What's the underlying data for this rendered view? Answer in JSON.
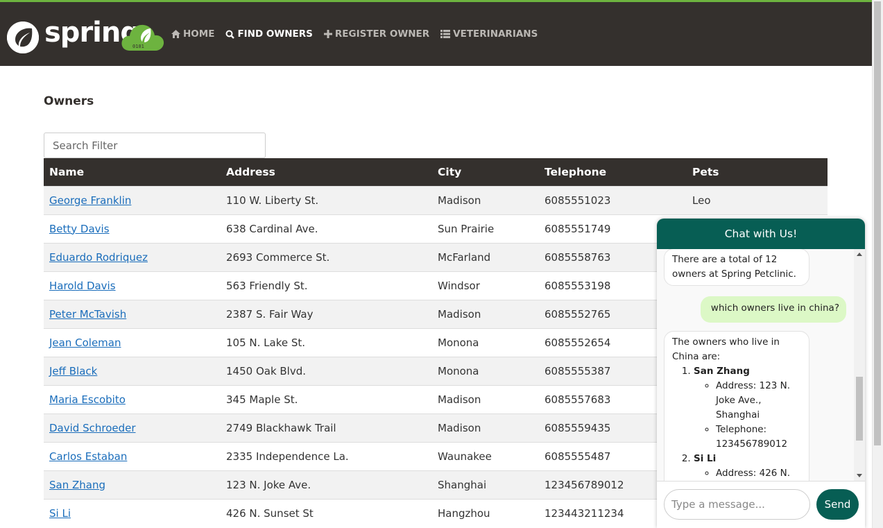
{
  "brand": {
    "name": "spring"
  },
  "nav": [
    {
      "label": "Home",
      "icon": "home-icon"
    },
    {
      "label": "Find owners",
      "icon": "search-icon"
    },
    {
      "label": "Register owner",
      "icon": "plus-icon"
    },
    {
      "label": "Veterinarians",
      "icon": "list-icon"
    }
  ],
  "page": {
    "title": "Owners"
  },
  "search": {
    "placeholder": "Search Filter",
    "value": ""
  },
  "table": {
    "headers": [
      "Name",
      "Address",
      "City",
      "Telephone",
      "Pets"
    ],
    "rows": [
      [
        "George Franklin",
        "110 W. Liberty St.",
        "Madison",
        "6085551023",
        "Leo"
      ],
      [
        "Betty Davis",
        "638 Cardinal Ave.",
        "Sun Prairie",
        "6085551749",
        ""
      ],
      [
        "Eduardo Rodriquez",
        "2693 Commerce St.",
        "McFarland",
        "6085558763",
        ""
      ],
      [
        "Harold Davis",
        "563 Friendly St.",
        "Windsor",
        "6085553198",
        ""
      ],
      [
        "Peter McTavish",
        "2387 S. Fair Way",
        "Madison",
        "6085552765",
        ""
      ],
      [
        "Jean Coleman",
        "105 N. Lake St.",
        "Monona",
        "6085552654",
        ""
      ],
      [
        "Jeff Black",
        "1450 Oak Blvd.",
        "Monona",
        "6085555387",
        ""
      ],
      [
        "Maria Escobito",
        "345 Maple St.",
        "Madison",
        "6085557683",
        ""
      ],
      [
        "David Schroeder",
        "2749 Blackhawk Trail",
        "Madison",
        "6085559435",
        ""
      ],
      [
        "Carlos Estaban",
        "2335 Independence La.",
        "Waunakee",
        "6085555487",
        ""
      ],
      [
        "San Zhang",
        "123 N. Joke Ave.",
        "Shanghai",
        "123456789012",
        ""
      ],
      [
        "Si Li",
        "426 N. Sunset St",
        "Hangzhou",
        "123443211234",
        ""
      ]
    ]
  },
  "chat": {
    "title": "Chat with Us!",
    "msg1": {
      "l1": "There are a total of 12",
      "l2": "owners at Spring Petclinic."
    },
    "msg2": "which owners live in china?",
    "msg3": {
      "l1": "The owners who live in",
      "l2": "China are:",
      "o1_name": "San Zhang",
      "o1_addr1": "Address: 123 N.",
      "o1_addr2": "Joke Ave.,",
      "o1_addr3": "Shanghai",
      "o1_tel1": "Telephone:",
      "o1_tel2": "123456789012",
      "o2_name": "Si Li",
      "o2_addr1": "Address: 426 N."
    },
    "input_placeholder": "Type a message...",
    "send_label": "Send"
  },
  "colors": {
    "navbar": "#34302d",
    "accent": "#6db33f",
    "chat": "#075e54",
    "user_bubble": "#dcf8c6",
    "link": "#1a6dbb"
  }
}
